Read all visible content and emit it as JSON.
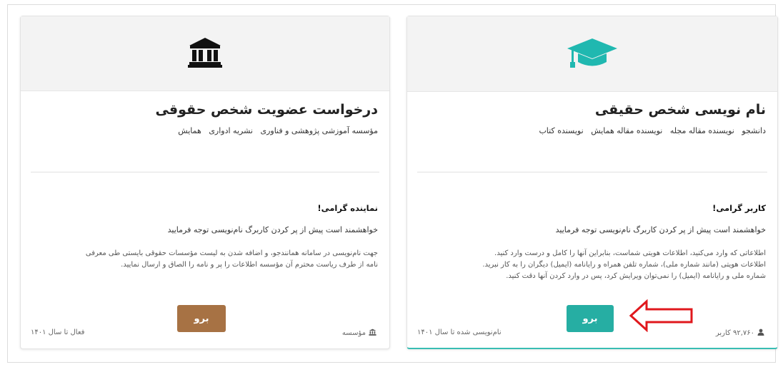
{
  "colors": {
    "accent_teal": "#26aea3",
    "accent_brown": "#a77244",
    "arrow_red": "#e0181d",
    "icon_teal": "#20b8b0"
  },
  "cards": {
    "legal": {
      "icon": "bank-building-icon",
      "title": "درخواست عضویت شخص حقوقی",
      "tags": [
        "مؤسسه آموزشی پژوهشی و فناوری",
        "نشریه ادواری",
        "همایش"
      ],
      "greeting": "نماینده گرامی!",
      "please": "خواهشمند است پیش از پر کردن کاربرگ نام‌نویسی توجه فرمایید",
      "paragraph": [
        "جهت نام‌نویسی در سامانه همانندجو، و اضافه شدن به لیست مؤسسات حقوقی بایستی طی معرفی",
        "نامه از طرف ریاست محترم آن مؤسسه اطلاعات را پر و نامه را الصاق و ارسال نمایید."
      ],
      "button_label": "برو",
      "footer_type": "مؤسسه",
      "footer_status": "فعال تا سال ۱۴۰۱"
    },
    "natural": {
      "icon": "graduation-cap-icon",
      "title": "نام نویسی شخص حقیقی",
      "tags": [
        "دانشجو",
        "نویسنده مقاله مجله",
        "نویسنده مقاله همایش",
        "نویسنده کتاب"
      ],
      "greeting": "کاربر گرامی!",
      "please": "خواهشمند است پیش از پر کردن کاربرگ نام‌نویسی توجه فرمایید",
      "paragraph": [
        "اطلاعاتی که وارد می‌کنید، اطلاعات هویتی شماست، بنابراین آنها را کامل و درست وارد کنید.",
        "اطلاعات هویتی (مانند شماره ملی)، شماره تلفن همراه و رایانامه (ایمیل) دیگران را به کار نبرید.",
        "شماره ملی و رایانامه (ایمیل) را نمی‌توان ویرایش کرد، پس در وارد کردن آنها دقت کنید."
      ],
      "button_label": "برو",
      "footer_users": "۹۲,۷۶۰ کاربر",
      "footer_status": "نام‌نویسی شده تا سال ۱۴۰۱"
    }
  }
}
